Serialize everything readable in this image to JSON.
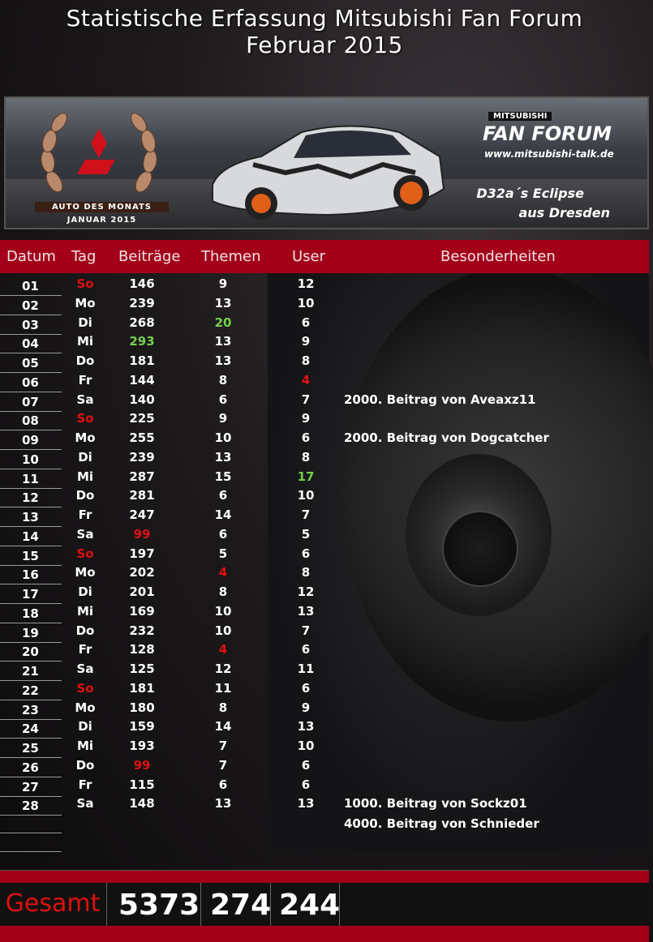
{
  "title": {
    "line1": "Statistische Erfassung Mitsubishi Fan Forum",
    "line2": "Februar 2015"
  },
  "banner": {
    "award_line1": "AUTO DES MONATS",
    "award_line2": "JANUAR 2015",
    "brand_small": "MITSUBISHI",
    "brand_big": "FAN FORUM",
    "brand_url": "www.mitsubishi-talk.de",
    "car_line1": "D32a´s Eclipse",
    "car_line2": "aus Dresden"
  },
  "columns": {
    "datum": "Datum",
    "tag": "Tag",
    "beitraege": "Beiträge",
    "themen": "Themen",
    "user": "User",
    "besonderheiten": "Besonderheiten"
  },
  "colors": {
    "header_bg": "#a30019",
    "highlight_low": "#e01010",
    "highlight_high": "#74d04a"
  },
  "rows": [
    {
      "datum": "01",
      "tag": "So",
      "beitraege": "146",
      "themen": "9",
      "user": "12",
      "note": ""
    },
    {
      "datum": "02",
      "tag": "Mo",
      "beitraege": "239",
      "themen": "13",
      "user": "10",
      "note": ""
    },
    {
      "datum": "03",
      "tag": "Di",
      "beitraege": "268",
      "themen": "20",
      "user": "6",
      "note": ""
    },
    {
      "datum": "04",
      "tag": "Mi",
      "beitraege": "293",
      "themen": "13",
      "user": "9",
      "note": ""
    },
    {
      "datum": "05",
      "tag": "Do",
      "beitraege": "181",
      "themen": "13",
      "user": "8",
      "note": ""
    },
    {
      "datum": "06",
      "tag": "Fr",
      "beitraege": "144",
      "themen": "8",
      "user": "4",
      "note": ""
    },
    {
      "datum": "07",
      "tag": "Sa",
      "beitraege": "140",
      "themen": "6",
      "user": "7",
      "note": "2000. Beitrag von Aveaxz11"
    },
    {
      "datum": "08",
      "tag": "So",
      "beitraege": "225",
      "themen": "9",
      "user": "9",
      "note": ""
    },
    {
      "datum": "09",
      "tag": "Mo",
      "beitraege": "255",
      "themen": "10",
      "user": "6",
      "note": "2000. Beitrag von Dogcatcher"
    },
    {
      "datum": "10",
      "tag": "Di",
      "beitraege": "239",
      "themen": "13",
      "user": "8",
      "note": ""
    },
    {
      "datum": "11",
      "tag": "Mi",
      "beitraege": "287",
      "themen": "15",
      "user": "17",
      "note": ""
    },
    {
      "datum": "12",
      "tag": "Do",
      "beitraege": "281",
      "themen": "6",
      "user": "10",
      "note": ""
    },
    {
      "datum": "13",
      "tag": "Fr",
      "beitraege": "247",
      "themen": "14",
      "user": "7",
      "note": ""
    },
    {
      "datum": "14",
      "tag": "Sa",
      "beitraege": "99",
      "themen": "6",
      "user": "5",
      "note": ""
    },
    {
      "datum": "15",
      "tag": "So",
      "beitraege": "197",
      "themen": "5",
      "user": "6",
      "note": ""
    },
    {
      "datum": "16",
      "tag": "Mo",
      "beitraege": "202",
      "themen": "4",
      "user": "8",
      "note": ""
    },
    {
      "datum": "17",
      "tag": "Di",
      "beitraege": "201",
      "themen": "8",
      "user": "12",
      "note": ""
    },
    {
      "datum": "18",
      "tag": "Mi",
      "beitraege": "169",
      "themen": "10",
      "user": "13",
      "note": ""
    },
    {
      "datum": "19",
      "tag": "Do",
      "beitraege": "232",
      "themen": "10",
      "user": "7",
      "note": ""
    },
    {
      "datum": "20",
      "tag": "Fr",
      "beitraege": "128",
      "themen": "4",
      "user": "6",
      "note": ""
    },
    {
      "datum": "21",
      "tag": "Sa",
      "beitraege": "125",
      "themen": "12",
      "user": "11",
      "note": ""
    },
    {
      "datum": "22",
      "tag": "So",
      "beitraege": "181",
      "themen": "11",
      "user": "6",
      "note": ""
    },
    {
      "datum": "23",
      "tag": "Mo",
      "beitraege": "180",
      "themen": "8",
      "user": "9",
      "note": ""
    },
    {
      "datum": "24",
      "tag": "Di",
      "beitraege": "159",
      "themen": "14",
      "user": "13",
      "note": ""
    },
    {
      "datum": "25",
      "tag": "Mi",
      "beitraege": "193",
      "themen": "7",
      "user": "10",
      "note": ""
    },
    {
      "datum": "26",
      "tag": "Do",
      "beitraege": "99",
      "themen": "7",
      "user": "6",
      "note": ""
    },
    {
      "datum": "27",
      "tag": "Fr",
      "beitraege": "115",
      "themen": "6",
      "user": "6",
      "note": ""
    },
    {
      "datum": "28",
      "tag": "Sa",
      "beitraege": "148",
      "themen": "13",
      "user": "13",
      "note": "1000. Beitrag von Sockz01"
    }
  ],
  "extra_note": "4000. Beitrag von Schnieder",
  "highlights": {
    "red_tag": [
      "01",
      "08",
      "15",
      "22"
    ],
    "red_beitraege": [
      "14",
      "26"
    ],
    "green_beitraege": [
      "04"
    ],
    "green_themen": [
      "03"
    ],
    "red_themen": [
      "16",
      "20"
    ],
    "green_user": [
      "11"
    ],
    "red_user": [
      "06"
    ]
  },
  "totals": {
    "label": "Gesamt",
    "beitraege": "5373",
    "themen": "274",
    "user": "244"
  }
}
